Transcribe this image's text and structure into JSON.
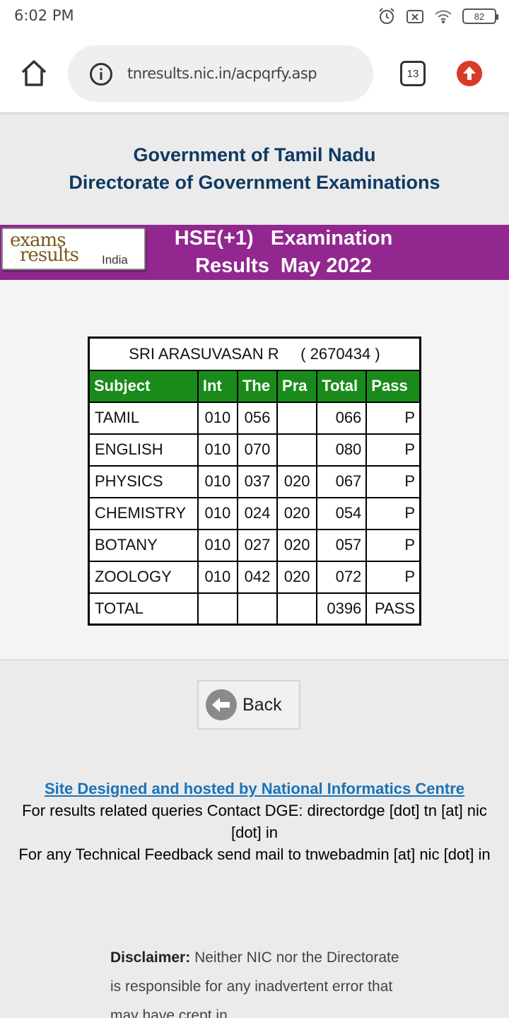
{
  "status_bar": {
    "time": "6:02 PM",
    "battery": "82"
  },
  "browser": {
    "url": "tnresults.nic.in/acpqrfy.asp",
    "tab_count": "13"
  },
  "header": {
    "line1": "Government of Tamil Nadu",
    "line2": "Directorate of Government Examinations"
  },
  "banner": {
    "logo_exams": "exams",
    "logo_results": "results",
    "logo_india": "India",
    "title_line1": "HSE(+1)   Examination",
    "title_line2": "Results  May 2022"
  },
  "result": {
    "student_name": "SRI ARASUVASAN R",
    "reg_no": "( 2670434 )",
    "columns": [
      "Subject",
      "Int",
      "The",
      "Pra",
      "Total",
      "Pass"
    ],
    "rows": [
      {
        "subject": "TAMIL",
        "int": "010",
        "the": "056",
        "pra": "",
        "total": "066",
        "pass": "P"
      },
      {
        "subject": "ENGLISH",
        "int": "010",
        "the": "070",
        "pra": "",
        "total": "080",
        "pass": "P"
      },
      {
        "subject": "PHYSICS",
        "int": "010",
        "the": "037",
        "pra": "020",
        "total": "067",
        "pass": "P"
      },
      {
        "subject": "CHEMISTRY",
        "int": "010",
        "the": "024",
        "pra": "020",
        "total": "054",
        "pass": "P"
      },
      {
        "subject": "BOTANY",
        "int": "010",
        "the": "027",
        "pra": "020",
        "total": "057",
        "pass": "P"
      },
      {
        "subject": "ZOOLOGY",
        "int": "010",
        "the": "042",
        "pra": "020",
        "total": "072",
        "pass": "P"
      }
    ],
    "total_row": {
      "subject": "TOTAL",
      "int": "",
      "the": "",
      "pra": "",
      "total": "0396",
      "pass": "PASS"
    }
  },
  "back_button": {
    "label": "Back"
  },
  "footer": {
    "link": "Site Designed and hosted by National Informatics Centre",
    "line1": "For results related queries Contact DGE:  directordge [dot] tn [at] nic [dot] in",
    "line2": "For any Technical Feedback send mail to tnwebadmin [at] nic [dot] in"
  },
  "disclaimer": {
    "label": "Disclaimer:",
    "text": " Neither NIC nor the Directorate is responsible for any inadvertent error that may have crept in"
  },
  "colors": {
    "banner": "#92278f",
    "header_text": "#0e3a63",
    "table_header": "#1a8b1a",
    "link": "#1a73b8",
    "upload_button": "#d93a2a"
  }
}
